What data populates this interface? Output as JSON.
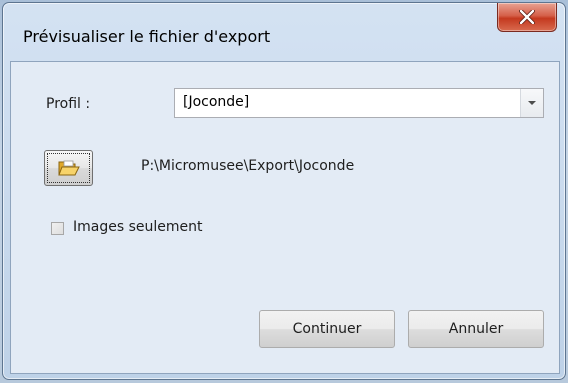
{
  "window": {
    "title": "Prévisualiser le fichier d'export",
    "close_icon": "close-x-icon"
  },
  "form": {
    "profile_label": "Profil :",
    "profile_value": "[Joconde]",
    "dropdown_icon": "chevron-down-icon",
    "browse_icon": "open-folder-icon",
    "export_path": "P:\\Micromusee\\Export\\Joconde",
    "images_only_label": "Images seulement",
    "images_only_checked": false
  },
  "buttons": {
    "continue_label": "Continuer",
    "cancel_label": "Annuler"
  },
  "colors": {
    "close_button": "#c4391f",
    "client_background": "#e3ebf5"
  }
}
